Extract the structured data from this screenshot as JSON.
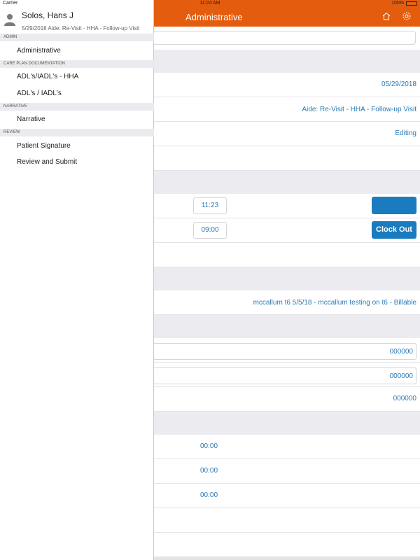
{
  "status_bar": {
    "carrier": "Carrier",
    "time": "11:24 AM",
    "battery": "100%",
    "battery_level": 1.0
  },
  "app_bar": {
    "title": "Administrative"
  },
  "patient": {
    "name": "Solos, Hans J",
    "visit": "5/29/2018 Aide: Re-Visit - HHA - Follow-up Visit"
  },
  "menu": {
    "sections": [
      {
        "header": "ADMIN",
        "items": [
          "Administrative"
        ]
      },
      {
        "header": "CARE PLAN DOCUMENTATION",
        "items": [
          "ADL's/IADL's - HHA",
          "ADL's / IADL's"
        ]
      },
      {
        "header": "NARRATIVE",
        "items": [
          "Narrative"
        ]
      },
      {
        "header": "REVIEW",
        "items": [
          "Patient Signature",
          "Review and Submit"
        ]
      }
    ]
  },
  "content": {
    "visit_date": "05/29/2018",
    "visit_type": "Aide: Re-Visit - HHA - Follow-up Visit",
    "status": "Editing",
    "time_in": "11:23",
    "time_out": "09:00",
    "clock_out_label": "Clock Out",
    "billing": "mccallum t6 5/5/18 - mccallum testing on t6 - Billable",
    "number_1": "000000",
    "number_2": "000000",
    "number_3": "000000",
    "duration_1": "00:00",
    "duration_2": "00:00",
    "duration_3": "00:00"
  },
  "colors": {
    "accent": "#e45d0e",
    "link": "#2a79b6",
    "button": "#1a7bbf"
  }
}
